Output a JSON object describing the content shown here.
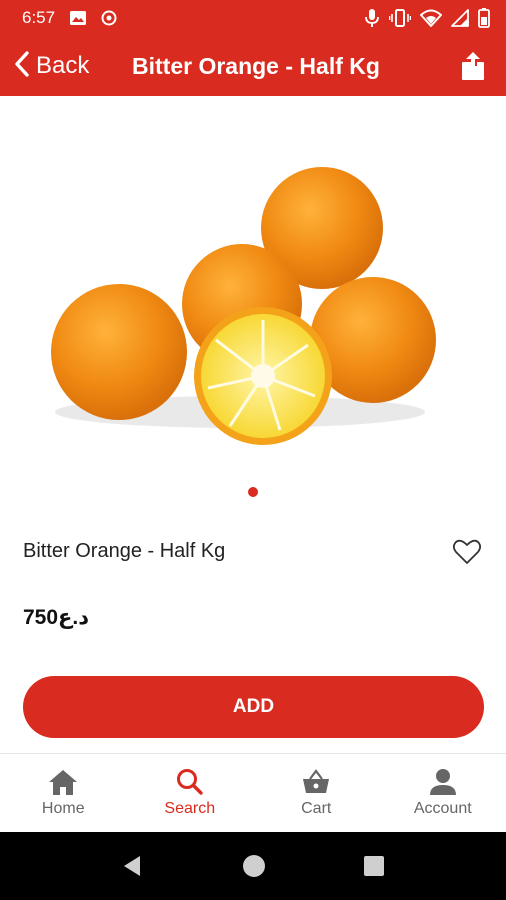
{
  "status_bar": {
    "time": "6:57",
    "left_icons": [
      "image-icon",
      "record-icon"
    ],
    "right_icons": [
      "mic-icon",
      "vibrate-icon",
      "wifi-icon",
      "signal-icon",
      "battery-icon"
    ]
  },
  "header": {
    "back_label": "Back",
    "title": "Bitter Orange - Half Kg",
    "share_icon": "share-icon"
  },
  "product": {
    "image_icon": "bitter-orange-image",
    "carousel_pages": 1,
    "carousel_current": 1,
    "name": "Bitter Orange - Half Kg",
    "price": "750د.ع",
    "favorite_icon": "heart-outline-icon",
    "add_label": "ADD"
  },
  "bottom_nav": {
    "items": [
      {
        "label": "Home",
        "icon": "home-icon",
        "active": false
      },
      {
        "label": "Search",
        "icon": "search-icon",
        "active": true
      },
      {
        "label": "Cart",
        "icon": "basket-icon",
        "active": false
      },
      {
        "label": "Account",
        "icon": "person-icon",
        "active": false
      }
    ]
  },
  "colors": {
    "accent": "#d92b1f",
    "inactive": "#666666",
    "system_nav": "#000000"
  }
}
